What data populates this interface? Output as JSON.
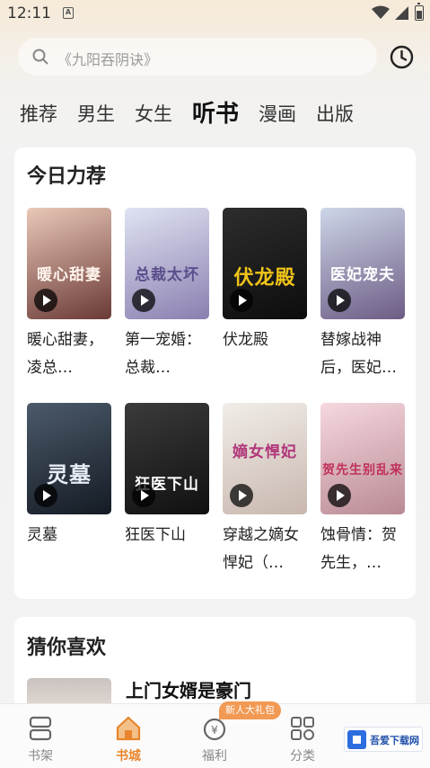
{
  "status": {
    "time": "12:11",
    "indicator": "A"
  },
  "search": {
    "placeholder": "《九阳吞阴诀》"
  },
  "tabs": [
    {
      "label": "推荐",
      "active": false
    },
    {
      "label": "男生",
      "active": false
    },
    {
      "label": "女生",
      "active": false
    },
    {
      "label": "听书",
      "active": true
    },
    {
      "label": "漫画",
      "active": false
    },
    {
      "label": "出版",
      "active": false
    }
  ],
  "today": {
    "title": "今日力荐",
    "books": [
      {
        "title": "暖心甜妻，凌总…",
        "cover_text": "暖心甜妻",
        "cover_colors": [
          "#e9c8b8",
          "#6b3a36"
        ]
      },
      {
        "title": "第一宠婚：总裁…",
        "cover_text": "总裁太坏",
        "cover_colors": [
          "#dfe3f2",
          "#8a7fb0"
        ]
      },
      {
        "title": "伏龙殿",
        "cover_text": "伏龙殿",
        "cover_colors": [
          "#2d2d2d",
          "#0d0d0d"
        ]
      },
      {
        "title": "替嫁战神后，医妃…",
        "cover_text": "医妃宠夫",
        "cover_colors": [
          "#cdd6e8",
          "#6d5c85"
        ]
      },
      {
        "title": "灵墓",
        "cover_text": "灵墓",
        "cover_colors": [
          "#4c5a6a",
          "#141b24"
        ]
      },
      {
        "title": "狂医下山",
        "cover_text": "狂医下山",
        "cover_colors": [
          "#3b3b3b",
          "#101010"
        ]
      },
      {
        "title": "穿越之嫡女悍妃（…",
        "cover_text": "嫡女悍妃",
        "cover_colors": [
          "#f1ede8",
          "#c8b7ae"
        ]
      },
      {
        "title": "蚀骨情：贺先生，…",
        "cover_text": "贺先生别乱来",
        "cover_colors": [
          "#f6d8df",
          "#b98a94"
        ]
      }
    ]
  },
  "guess": {
    "title": "猜你喜欢",
    "first_book": "上门女婿是豪门"
  },
  "bottom_nav": [
    {
      "label": "书架",
      "icon": "bookshelf-icon",
      "active": false
    },
    {
      "label": "书城",
      "icon": "store-icon",
      "active": true
    },
    {
      "label": "福利",
      "icon": "welfare-icon",
      "active": false
    },
    {
      "label": "分类",
      "icon": "category-icon",
      "active": false
    }
  ],
  "gift_badge": "新人大礼包",
  "watermark": "吾爱下载网",
  "colors": {
    "accent": "#e8852c",
    "badge": "#f29a55"
  }
}
